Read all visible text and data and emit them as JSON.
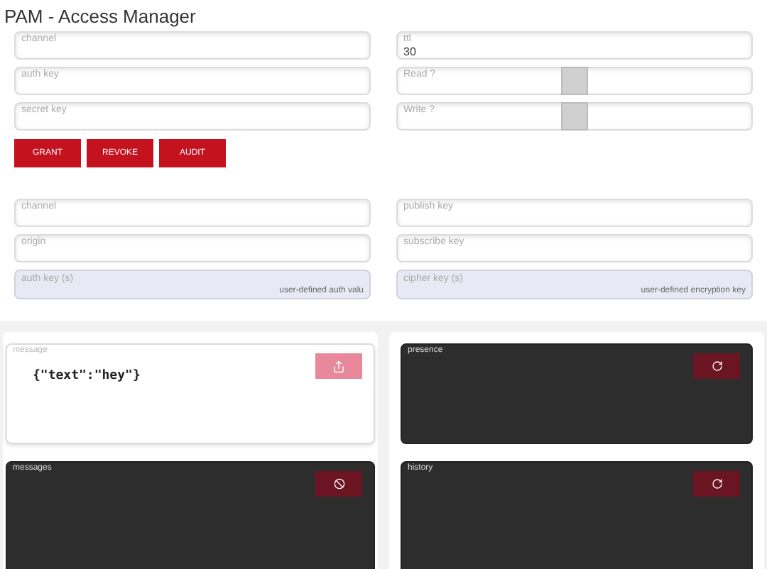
{
  "title": "PAM - Access Manager",
  "access": {
    "left": [
      {
        "kind": "text",
        "label": "channel"
      },
      {
        "kind": "text",
        "label": "auth key"
      },
      {
        "kind": "text",
        "label": "secret key"
      }
    ],
    "right": [
      {
        "kind": "text",
        "label": "ttl",
        "value": "30"
      },
      {
        "kind": "slider",
        "label": "Read ?",
        "level": 0.5
      },
      {
        "kind": "slider",
        "label": "Write ?",
        "level": 0.5
      }
    ],
    "buttons": [
      "GRANT",
      "REVOKE",
      "AUDIT"
    ]
  },
  "config": {
    "left": [
      {
        "kind": "text",
        "label": "channel"
      },
      {
        "kind": "text",
        "label": "origin"
      },
      {
        "kind": "keys",
        "label": "auth key (s)",
        "value": "user-defined auth valu"
      }
    ],
    "right": [
      {
        "kind": "text",
        "label": "publish key"
      },
      {
        "kind": "text",
        "label": "subscribe key"
      },
      {
        "kind": "keys",
        "label": "cipher key (s)",
        "value": "user-defined encryption key"
      }
    ]
  },
  "panels": {
    "left": [
      {
        "kind": "light",
        "label": "message",
        "content": "{\"text\":\"hey\"}",
        "button": {
          "kind": "send"
        }
      },
      {
        "kind": "dark",
        "label": "messages",
        "button": {
          "kind": "ban"
        }
      }
    ],
    "right": [
      {
        "kind": "dark",
        "label": "presence",
        "button": {
          "kind": "refresh"
        }
      },
      {
        "kind": "dark",
        "label": "history",
        "button": {
          "kind": "refresh"
        }
      }
    ]
  }
}
